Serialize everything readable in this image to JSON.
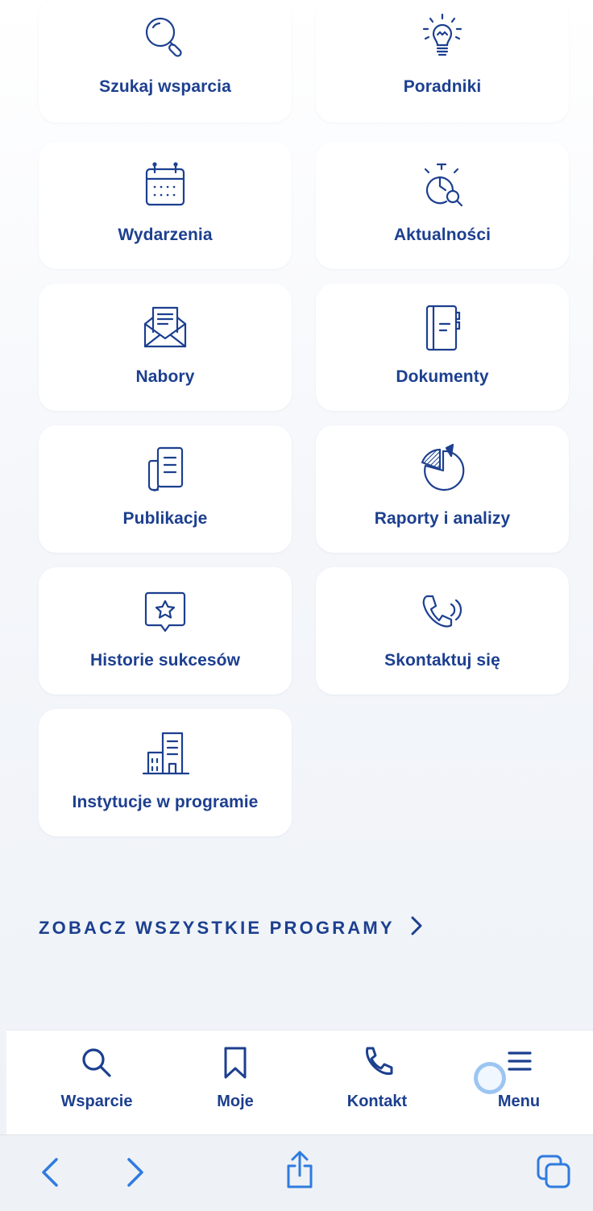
{
  "tiles": [
    {
      "label": "Szukaj wsparcia",
      "icon": "magnifier-icon"
    },
    {
      "label": "Poradniki",
      "icon": "lightbulb-icon"
    },
    {
      "label": "Wydarzenia",
      "icon": "calendar-icon"
    },
    {
      "label": "Aktualności",
      "icon": "stopwatch-search-icon"
    },
    {
      "label": "Nabory",
      "icon": "envelope-letter-icon"
    },
    {
      "label": "Dokumenty",
      "icon": "notebook-icon"
    },
    {
      "label": "Publikacje",
      "icon": "document-stack-icon"
    },
    {
      "label": "Raporty i analizy",
      "icon": "pie-chart-icon"
    },
    {
      "label": "Historie sukcesów",
      "icon": "star-speech-bubble-icon"
    },
    {
      "label": "Skontaktuj się",
      "icon": "phone-ringing-icon"
    },
    {
      "label": "Instytucje w programie",
      "icon": "buildings-icon"
    }
  ],
  "see_all": {
    "label": "ZOBACZ WSZYSTKIE PROGRAMY",
    "icon": "chevron-right-icon"
  },
  "tabbar": [
    {
      "label": "Wsparcie",
      "icon": "search-icon"
    },
    {
      "label": "Moje",
      "icon": "bookmark-icon"
    },
    {
      "label": "Kontakt",
      "icon": "phone-icon"
    },
    {
      "label": "Menu",
      "icon": "hamburger-menu-icon"
    }
  ],
  "browser_toolbar": {
    "icons": [
      "back-chevron-icon",
      "forward-chevron-icon",
      "share-icon",
      "tabs-icon"
    ]
  },
  "colors": {
    "accent": "#1c3f8f",
    "link_blue": "#2f7be0",
    "tile_bg": "#ffffff"
  }
}
